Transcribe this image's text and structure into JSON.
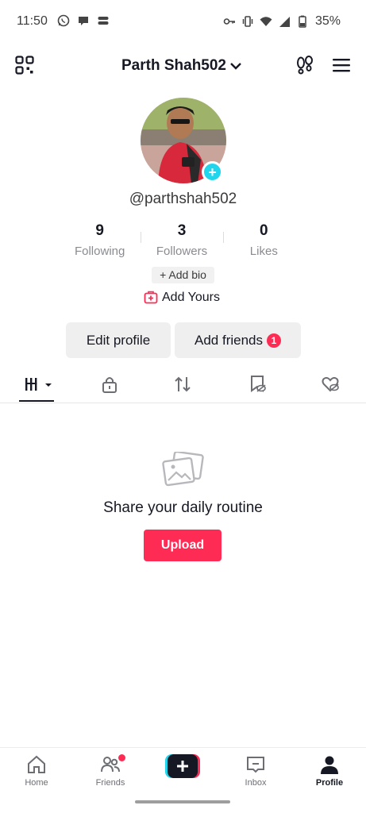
{
  "status_bar": {
    "time": "11:50",
    "battery": "35%"
  },
  "header": {
    "title": "Parth Shah502"
  },
  "profile": {
    "username": "@parthshah502",
    "stats": [
      {
        "value": "9",
        "label": "Following"
      },
      {
        "value": "3",
        "label": "Followers"
      },
      {
        "value": "0",
        "label": "Likes"
      }
    ],
    "add_bio": "+ Add bio",
    "add_yours": "Add Yours"
  },
  "actions": {
    "edit_profile": "Edit profile",
    "add_friends": "Add friends",
    "add_friends_badge": "1"
  },
  "empty_state": {
    "title": "Share your daily routine",
    "upload": "Upload"
  },
  "bottom_nav": [
    {
      "label": "Home"
    },
    {
      "label": "Friends"
    },
    {
      "label": ""
    },
    {
      "label": "Inbox"
    },
    {
      "label": "Profile"
    }
  ],
  "colors": {
    "accent": "#fe2c55",
    "cyan": "#20d5ec"
  }
}
